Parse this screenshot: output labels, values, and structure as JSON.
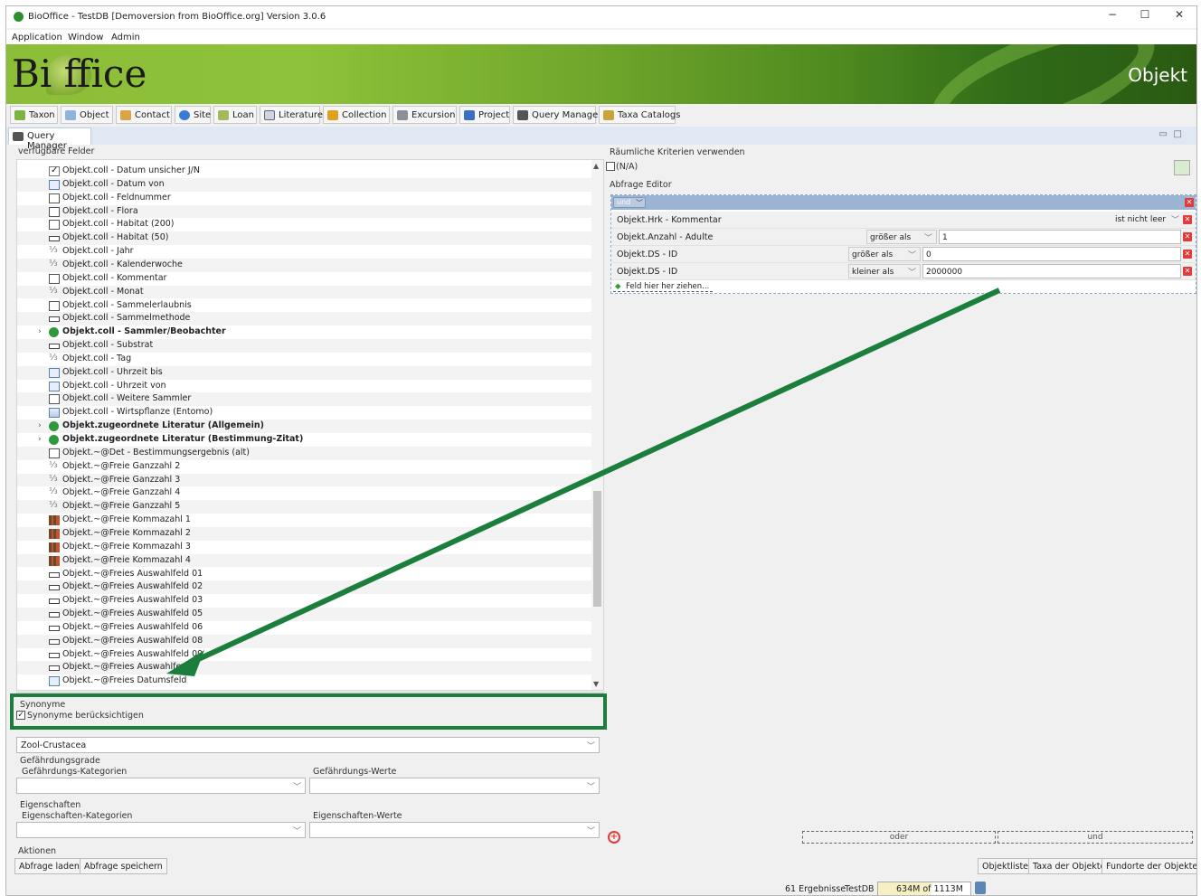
{
  "window": {
    "title": "BioOffice - TestDB [Demoversion from BioOffice.org] Version 3.0.6",
    "controls": [
      "−",
      "☐",
      "✕"
    ]
  },
  "menu": [
    "Application",
    "Window",
    "Admin"
  ],
  "banner": {
    "logo": "Bi  ffice",
    "section": "Objekt"
  },
  "toolbar": [
    "Taxon",
    "Object",
    "Contact",
    "Site",
    "Loan",
    "Literature",
    "Collection",
    "Excursion",
    "Project",
    "Query Manager",
    "Taxa Catalogs"
  ],
  "tab": {
    "label": "Query Manager"
  },
  "left": {
    "fields_label": "verfügbare Felder",
    "fields": [
      {
        "label": "Objekt.coll - Datum unsicher J/N",
        "icon": "checkbox-icon"
      },
      {
        "label": "Objekt.coll - Datum von",
        "icon": "calendar-icon"
      },
      {
        "label": "Objekt.coll - Feldnummer",
        "icon": "text-field-icon"
      },
      {
        "label": "Objekt.coll - Flora",
        "icon": "text-field-icon"
      },
      {
        "label": "Objekt.coll - Habitat (200)",
        "icon": "text-field-icon"
      },
      {
        "label": "Objekt.coll - Habitat (50)",
        "icon": "select-field-icon"
      },
      {
        "label": "Objekt.coll - Jahr",
        "icon": "number-field-icon"
      },
      {
        "label": "Objekt.coll - Kalenderwoche",
        "icon": "number-field-icon"
      },
      {
        "label": "Objekt.coll - Kommentar",
        "icon": "text-field-icon"
      },
      {
        "label": "Objekt.coll - Monat",
        "icon": "number-field-icon"
      },
      {
        "label": "Objekt.coll - Sammelerlaubnis",
        "icon": "text-field-icon"
      },
      {
        "label": "Objekt.coll - Sammelmethode",
        "icon": "select-field-icon"
      },
      {
        "label": "Objekt.coll - Sammler/Beobachter",
        "icon": "link-icon",
        "bold": true,
        "expandable": true
      },
      {
        "label": "Objekt.coll - Substrat",
        "icon": "select-field-icon"
      },
      {
        "label": "Objekt.coll - Tag",
        "icon": "number-field-icon"
      },
      {
        "label": "Objekt.coll - Uhrzeit bis",
        "icon": "calendar-icon"
      },
      {
        "label": "Objekt.coll - Uhrzeit von",
        "icon": "calendar-icon"
      },
      {
        "label": "Objekt.coll - Weitere Sammler",
        "icon": "text-field-icon"
      },
      {
        "label": "Objekt.coll - Wirtspflanze (Entomo)",
        "icon": "image-field-icon"
      },
      {
        "label": "Objekt.zugeordnete Literatur (Allgemein)",
        "icon": "link-icon",
        "bold": true,
        "expandable": true
      },
      {
        "label": "Objekt.zugeordnete Literatur (Bestimmung-Zitat)",
        "icon": "link-icon",
        "bold": true,
        "expandable": true
      },
      {
        "label": "Objekt.~@Det - Bestimmungsergebnis (alt)",
        "icon": "text-field-icon"
      },
      {
        "label": "Objekt.~@Freie Ganzzahl 2",
        "icon": "number-field-icon"
      },
      {
        "label": "Objekt.~@Freie Ganzzahl 3",
        "icon": "number-field-icon"
      },
      {
        "label": "Objekt.~@Freie Ganzzahl 4",
        "icon": "number-field-icon"
      },
      {
        "label": "Objekt.~@Freie Ganzzahl 5",
        "icon": "number-field-icon"
      },
      {
        "label": "Objekt.~@Freie Kommazahl 1",
        "icon": "decimal-field-icon"
      },
      {
        "label": "Objekt.~@Freie Kommazahl 2",
        "icon": "decimal-field-icon"
      },
      {
        "label": "Objekt.~@Freie Kommazahl 3",
        "icon": "decimal-field-icon"
      },
      {
        "label": "Objekt.~@Freie Kommazahl 4",
        "icon": "decimal-field-icon"
      },
      {
        "label": "Objekt.~@Freies Auswahlfeld 01",
        "icon": "select-field-icon"
      },
      {
        "label": "Objekt.~@Freies Auswahlfeld 02",
        "icon": "select-field-icon"
      },
      {
        "label": "Objekt.~@Freies Auswahlfeld 03",
        "icon": "select-field-icon"
      },
      {
        "label": "Objekt.~@Freies Auswahlfeld 05",
        "icon": "select-field-icon"
      },
      {
        "label": "Objekt.~@Freies Auswahlfeld 06",
        "icon": "select-field-icon"
      },
      {
        "label": "Objekt.~@Freies Auswahlfeld 08",
        "icon": "select-field-icon"
      },
      {
        "label": "Objekt.~@Freies Auswahlfeld 09",
        "icon": "select-field-icon"
      },
      {
        "label": "Objekt.~@Freies Auswahlfe",
        "icon": "select-field-icon"
      },
      {
        "label": "Objekt.~@Freies Datumsfeld",
        "icon": "calendar-icon"
      }
    ],
    "synonyme": {
      "group": "Synonyme",
      "checkbox_label": "Synonyme berücksichtigen"
    },
    "catalog_value": "Zool-Crustacea",
    "gefaehrdung": {
      "group": "Gefährdungsgrade",
      "kategorien": "Gefährdungs-Kategorien",
      "werte": "Gefährdungs-Werte"
    },
    "eigenschaften": {
      "group": "Eigenschaften",
      "kategorien": "Eigenschaften-Kategorien",
      "werte": "Eigenschaften-Werte"
    },
    "aktionen": {
      "group": "Aktionen",
      "load": "Abfrage laden",
      "save": "Abfrage speichern"
    }
  },
  "right": {
    "spatial_label": "Räumliche Kriterien verwenden",
    "spatial_value": "(N/A)",
    "editor_label": "Abfrage Editor",
    "op_combo": "und",
    "criteria": [
      {
        "field": "Objekt.Hrk - Kommentar",
        "operator": "ist nicht leer",
        "value": ""
      },
      {
        "field": "Objekt.Anzahl - Adulte",
        "operator": "größer als",
        "value": "1"
      },
      {
        "field": "Objekt.DS - ID",
        "operator": "größer als",
        "value": "0"
      },
      {
        "field": "Objekt.DS - ID",
        "operator": "kleiner als",
        "value": "2000000"
      }
    ],
    "drop_hint": "Feld hier her ziehen...",
    "oder": "oder",
    "und": "und",
    "buttons": [
      "Objektliste",
      "Taxa der Objekte",
      "Fundorte der Objekte"
    ]
  },
  "status": {
    "results": "61 Ergebnisse",
    "db": "TestDB",
    "memory": "634M of 1113M"
  },
  "colors": {
    "highlight": "#1b7f3b",
    "editor_header": "#9cb4d4",
    "delete": "#e23b3b"
  }
}
